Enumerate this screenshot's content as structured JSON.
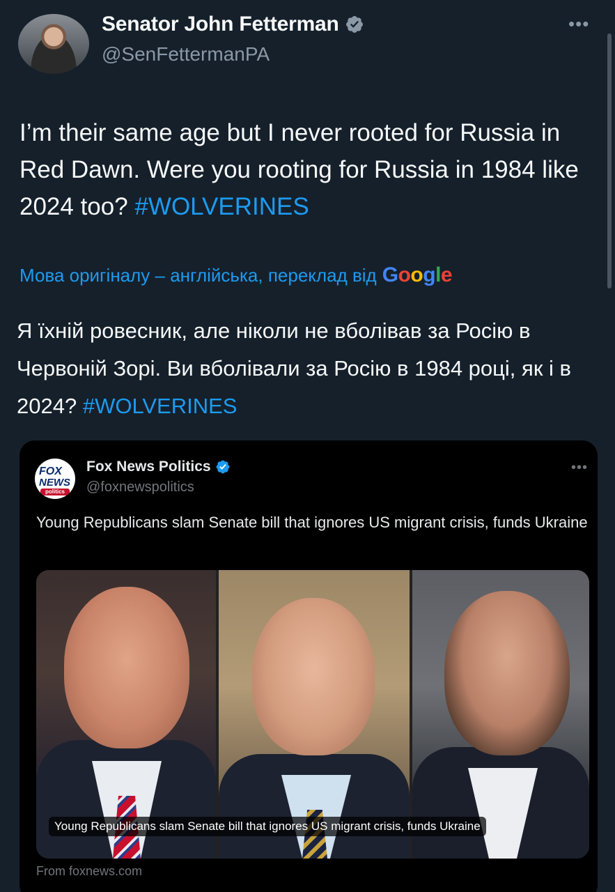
{
  "author": {
    "name": "Senator John Fetterman",
    "handle": "@SenFettermanPA",
    "verified_icon": "verified-badge-icon",
    "more_icon": "more-options-icon"
  },
  "tweet": {
    "text_part1": "I’m their same age but I never rooted for Russia in Red Dawn. Were you rooting for Russia in 1984 like 2024 too? ",
    "hashtag": "#WOLVERINES"
  },
  "translation": {
    "notice": "Мова оригіналу – англійська, переклад від",
    "provider": {
      "g1": "G",
      "o1": "o",
      "o2": "o",
      "g2": "g",
      "l": "l",
      "e": "e"
    },
    "text_part1": "Я їхній ровесник, але ніколи не вболівав за Росію в Червоній Зорі. Ви вболівали за Росію в 1984 році, як і в 2024? ",
    "hashtag": "#WOLVERINES"
  },
  "quoted": {
    "name": "Fox News Politics",
    "handle": "@foxnewspolitics",
    "logo_lines": [
      "FOX",
      "NEWS",
      "politics"
    ],
    "text": "Young Republicans slam Senate bill that ignores US migrant crisis, funds Ukraine",
    "media_caption": "Young Republicans slam Senate bill that ignores US migrant crisis, funds Ukraine",
    "source": "From foxnews.com",
    "more_icon": "more-options-icon"
  },
  "colors": {
    "background": "#15202b",
    "link": "#1d9bf0",
    "verified": "#1d9bf0",
    "secondary_text": "#8b98a5"
  }
}
